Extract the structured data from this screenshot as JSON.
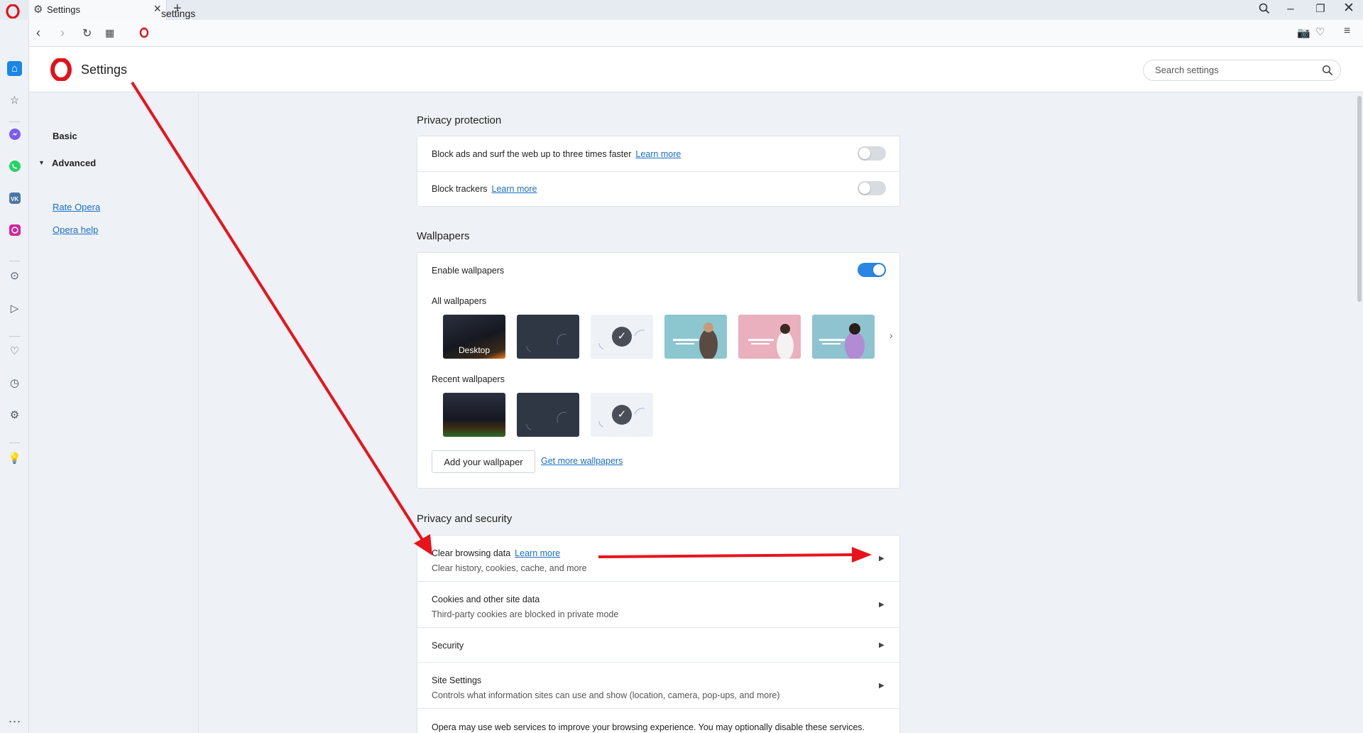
{
  "tab": {
    "title": "Settings"
  },
  "address": {
    "url": "settings"
  },
  "header": {
    "title": "Settings",
    "search_placeholder": "Search settings"
  },
  "nav": {
    "basic": "Basic",
    "advanced": "Advanced",
    "rate": "Rate Opera",
    "help": "Opera help"
  },
  "privacy_protection": {
    "title": "Privacy protection",
    "block_ads": "Block ads and surf the web up to three times faster",
    "block_ads_learn": "Learn more",
    "block_ads_enabled": false,
    "block_trackers": "Block trackers",
    "block_trackers_learn": "Learn more",
    "block_trackers_enabled": false
  },
  "wallpapers": {
    "title": "Wallpapers",
    "enable": "Enable wallpapers",
    "enabled": true,
    "all_label": "All wallpapers",
    "desktop_label": "Desktop",
    "recent_label": "Recent wallpapers",
    "add_button": "Add your wallpaper",
    "more_link": "Get more wallpapers"
  },
  "privacy_security": {
    "title": "Privacy and security",
    "clear_title": "Clear browsing data",
    "clear_learn": "Learn more",
    "clear_sub": "Clear history, cookies, cache, and more",
    "cookies_title": "Cookies and other site data",
    "cookies_sub": "Third-party cookies are blocked in private mode",
    "security_title": "Security",
    "site_title": "Site Settings",
    "site_sub": "Controls what information sites can use and show (location, camera, pop-ups, and more)",
    "web_services": "Opera may use web services to improve your browsing experience. You may optionally disable these services."
  },
  "colors": {
    "accent": "#2a85e6",
    "opera_red": "#e0121b",
    "annotation_red": "#e8131b"
  },
  "icons": {
    "sidebar": [
      "home-icon",
      "star-icon",
      "messenger-icon",
      "whatsapp-icon",
      "vk-icon",
      "instagram-icon",
      "player-icon",
      "send-icon",
      "heart-icon",
      "history-icon",
      "gear-icon",
      "lightbulb-icon",
      "more-icon"
    ]
  }
}
